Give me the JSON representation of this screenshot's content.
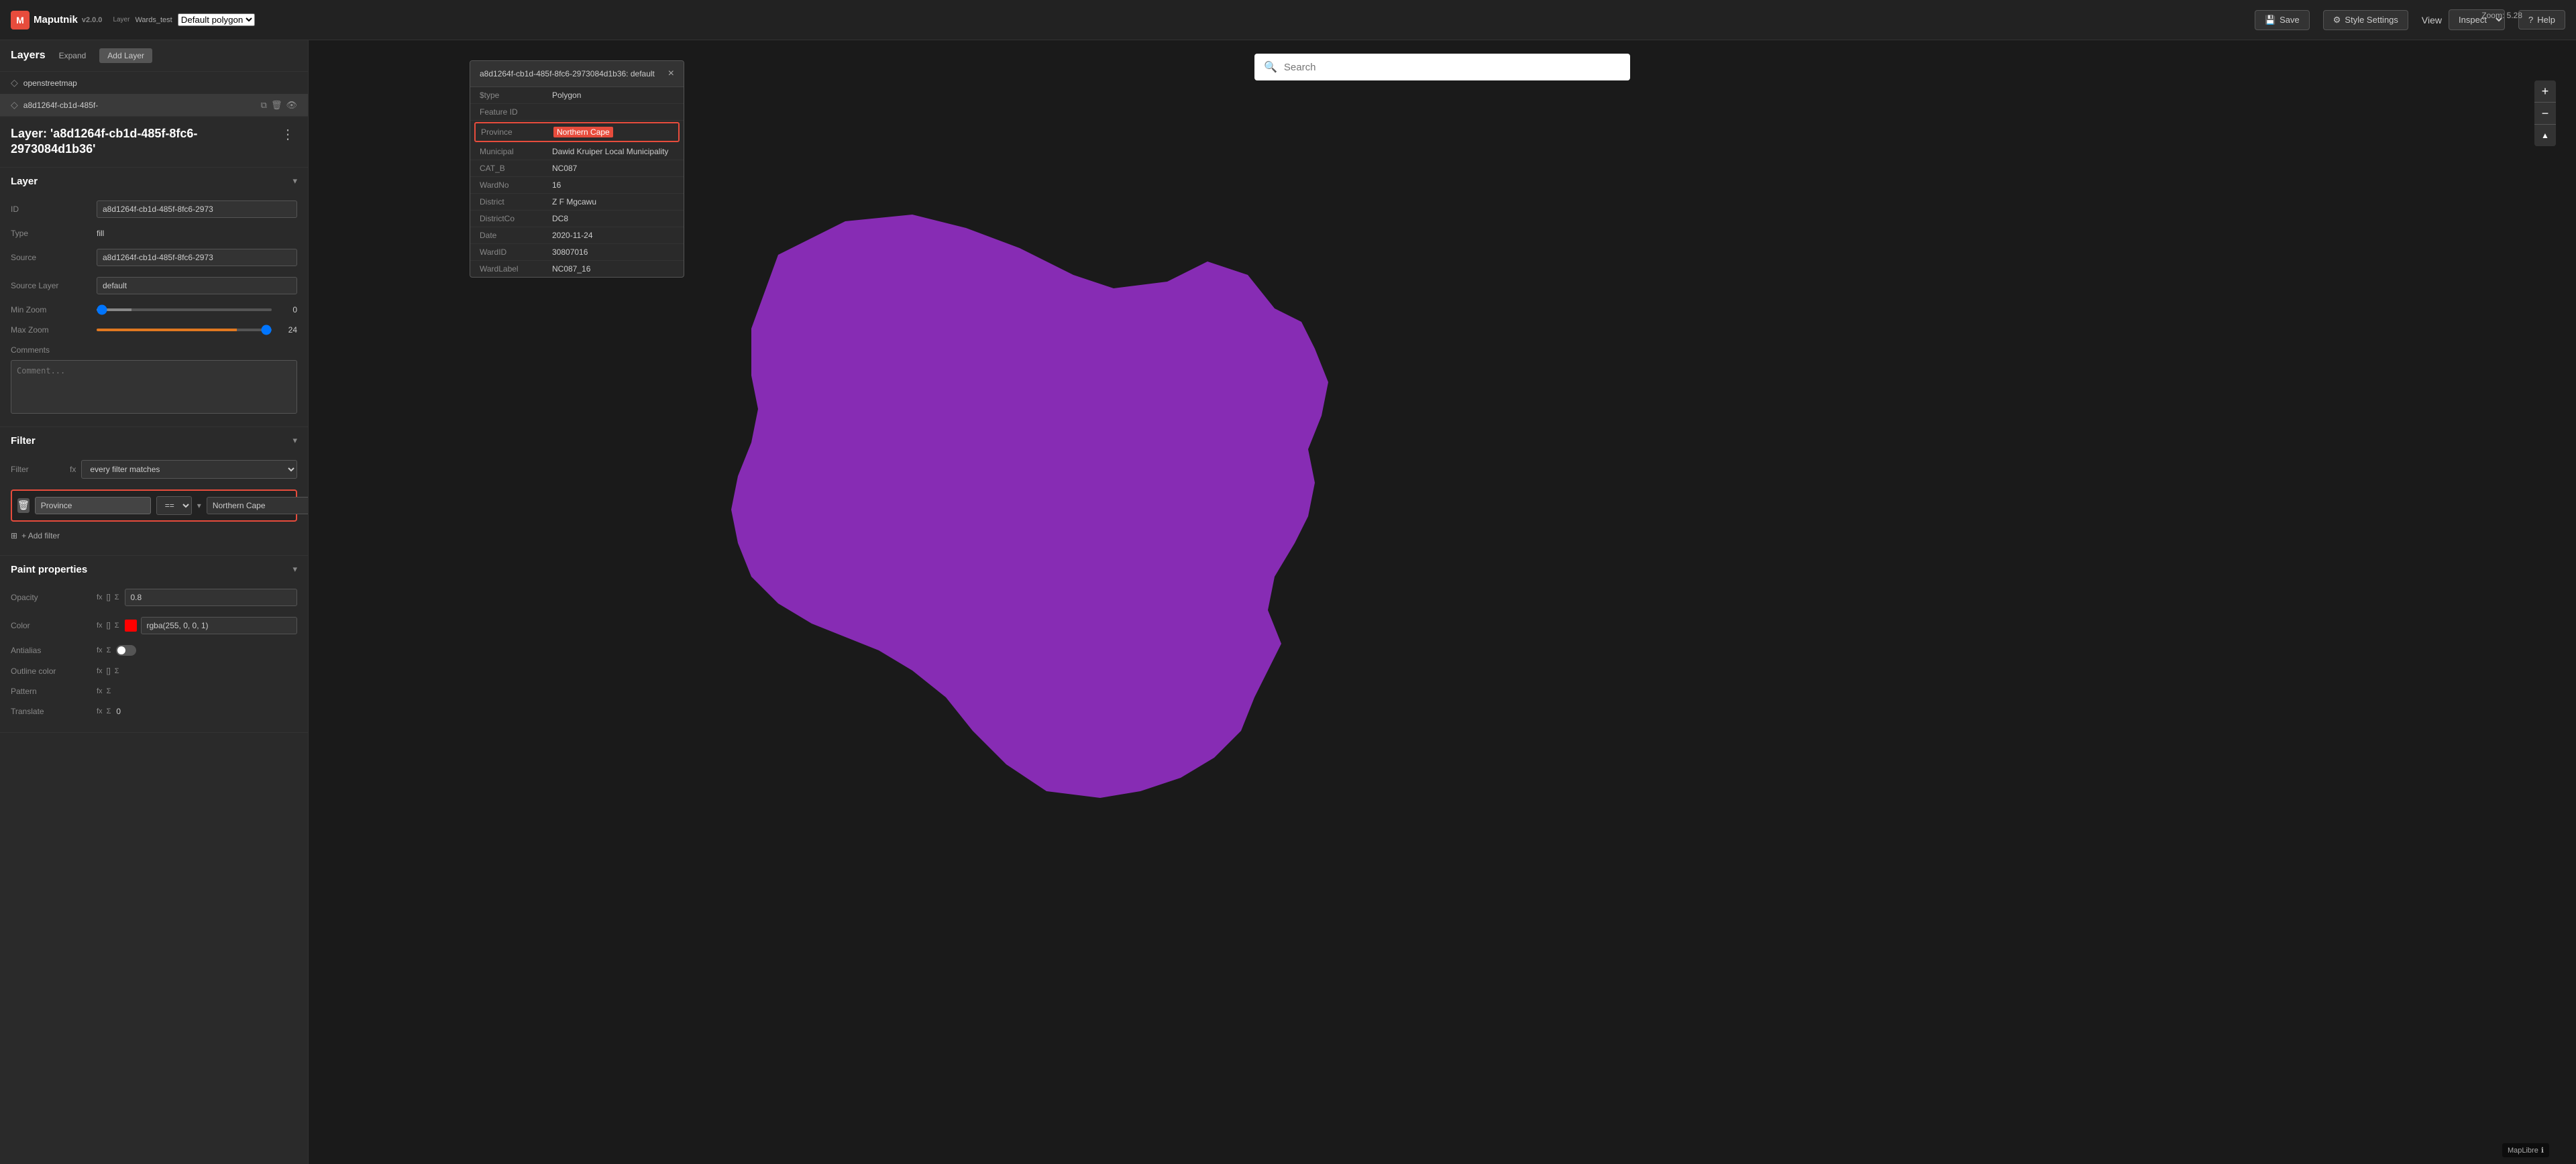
{
  "app": {
    "name": "Maputnik",
    "version": "v2.0.0",
    "logo_letter": "M"
  },
  "topbar": {
    "layer_label": "Layer",
    "layer_name": "Wards_test",
    "layer_type": "Default polygon",
    "save_label": "Save",
    "style_settings_label": "Style Settings",
    "view_label": "View",
    "inspect_label": "Inspect",
    "help_label": "Help",
    "zoom_display": "Zoom: 5.28"
  },
  "layers_panel": {
    "title": "Layers",
    "expand_label": "Expand",
    "add_layer_label": "Add Layer",
    "items": [
      {
        "name": "openstreetmap",
        "icon": "◇",
        "active": false
      },
      {
        "name": "a8d1264f-cb1d-485f-",
        "icon": "◇",
        "active": true
      }
    ]
  },
  "layer_detail": {
    "title": "Layer: 'a8d1264f-cb1d-485f-8fc6-2973084d1b36'",
    "section_label": "Layer",
    "id_label": "ID",
    "id_value": "a8d1264f-cb1d-485f-8fc6-2973",
    "type_label": "Type",
    "type_value": "fill",
    "source_label": "Source",
    "source_value": "a8d1264f-cb1d-485f-8fc6-2973",
    "source_layer_label": "Source Layer",
    "source_layer_value": "default",
    "min_zoom_label": "Min Zoom",
    "min_zoom_value": "0",
    "max_zoom_label": "Max Zoom",
    "max_zoom_value": "24",
    "comments_label": "Comments",
    "comments_placeholder": "Comment..."
  },
  "filter": {
    "section_label": "Filter",
    "filter_label": "Filter",
    "filter_type": "every filter matches",
    "condition": {
      "field": "Province",
      "operator": "==",
      "value": "Northern Cape"
    },
    "add_filter_label": "+ Add filter"
  },
  "paint": {
    "section_label": "Paint properties",
    "opacity_label": "Opacity",
    "opacity_value": "0.8",
    "color_label": "Color",
    "color_value": "rgba(255, 0, 0, 1)",
    "color_swatch": "#ff0000",
    "antialias_label": "Antialias",
    "outline_color_label": "Outline color",
    "pattern_label": "Pattern",
    "translate_label": "Translate"
  },
  "search": {
    "placeholder": "Search"
  },
  "feature_popup": {
    "title": "a8d1264f-cb1d-485f-8fc6-2973084d1b36: default",
    "type_key": "$type",
    "type_value": "Polygon",
    "feature_id_key": "Feature ID",
    "feature_id_value": "",
    "rows": [
      {
        "key": "Province",
        "value": "Northern Cape",
        "highlighted": true
      },
      {
        "key": "Municipal",
        "value": "Dawid Kruiper Local Municipality"
      },
      {
        "key": "CAT_B",
        "value": "NC087"
      },
      {
        "key": "WardNo",
        "value": "16"
      },
      {
        "key": "District",
        "value": "Z F Mgcawu"
      },
      {
        "key": "DistrictCo",
        "value": "DC8"
      },
      {
        "key": "Date",
        "value": "2020-11-24"
      },
      {
        "key": "WardID",
        "value": "30807016"
      },
      {
        "key": "WardLabel",
        "value": "NC087_16"
      }
    ]
  },
  "maplibre_badge": "MapLibre",
  "icons": {
    "search": "🔍",
    "gear": "⚙",
    "eye": "◇",
    "plus": "+",
    "minus": "−",
    "arrow_down": "▾",
    "three_dot": "⋮",
    "close": "×",
    "trash": "🗑",
    "fx": "fx",
    "sigma": "Σ",
    "array": "[]",
    "info": "ℹ"
  }
}
